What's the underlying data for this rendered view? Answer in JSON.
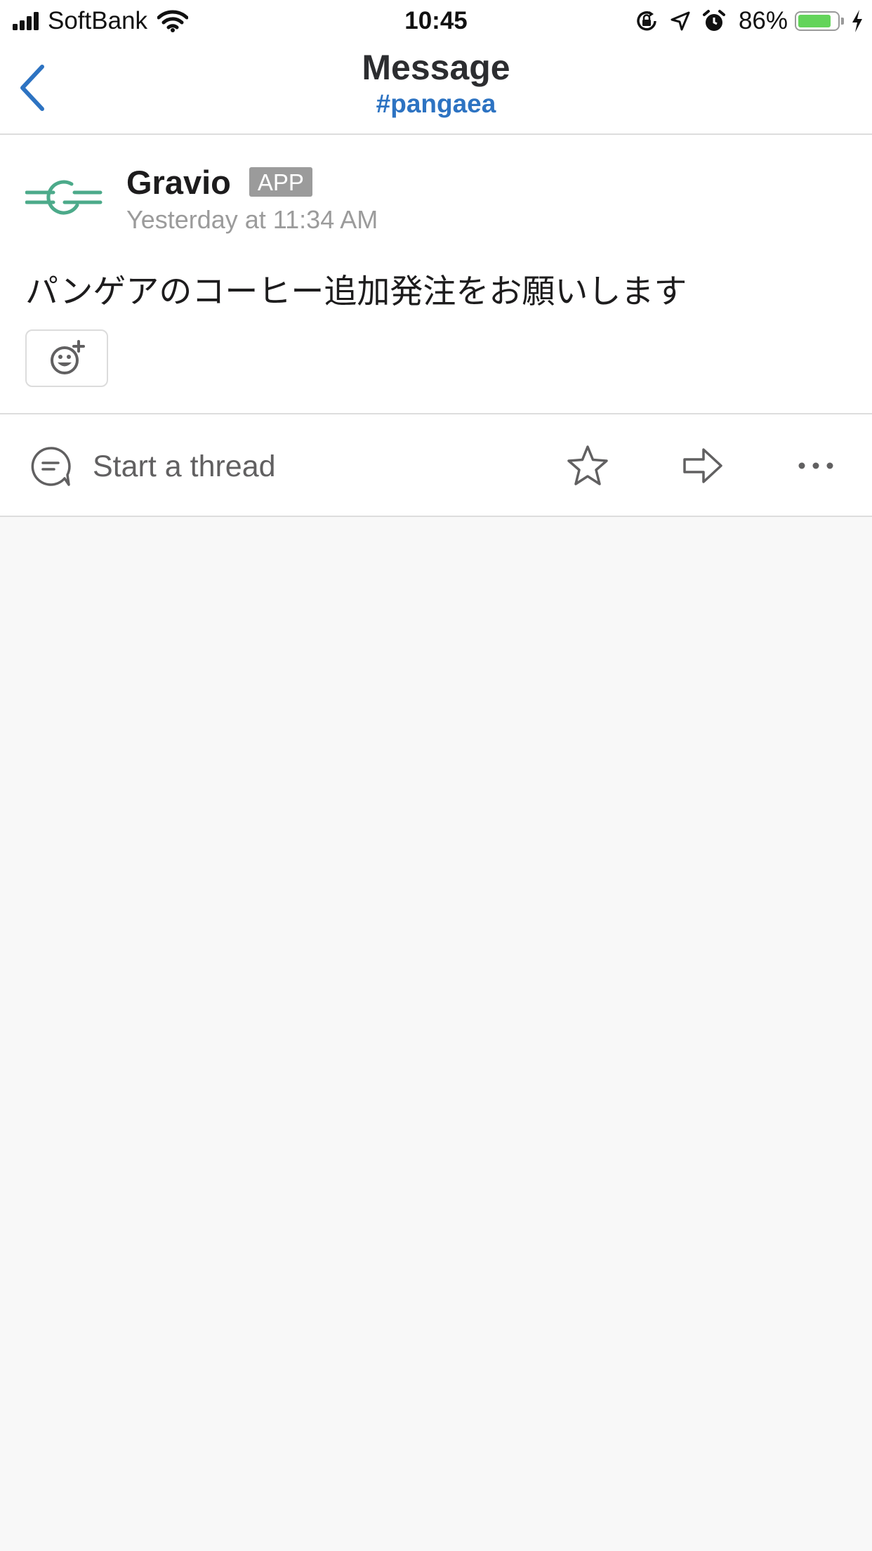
{
  "status_bar": {
    "carrier": "SoftBank",
    "time": "10:45",
    "battery_percent": "86%",
    "battery_level": 0.86,
    "icons": [
      "signal-icon",
      "wifi-icon",
      "rotation-lock-icon",
      "location-icon",
      "alarm-icon",
      "battery-icon",
      "charging-icon"
    ]
  },
  "navbar": {
    "title": "Message",
    "subtitle": "#pangaea",
    "back_icon": "chevron-left-icon"
  },
  "message": {
    "sender": "Gravio",
    "badge": "APP",
    "timestamp": "Yesterday at 11:34 AM",
    "text": "パンゲアのコーヒー追加発注をお願いします",
    "avatar_icon": "gravio-logo",
    "reaction_icon": "add-reaction-icon"
  },
  "actions": {
    "thread_label": "Start a thread",
    "icons": [
      "thread-icon",
      "star-icon",
      "share-icon",
      "more-icon"
    ]
  },
  "colors": {
    "accent": "#2d73c2",
    "logo": "#4caa8a",
    "badge": "#9b9b9b",
    "battery": "#63d45a",
    "background": "#f8f8f8"
  }
}
